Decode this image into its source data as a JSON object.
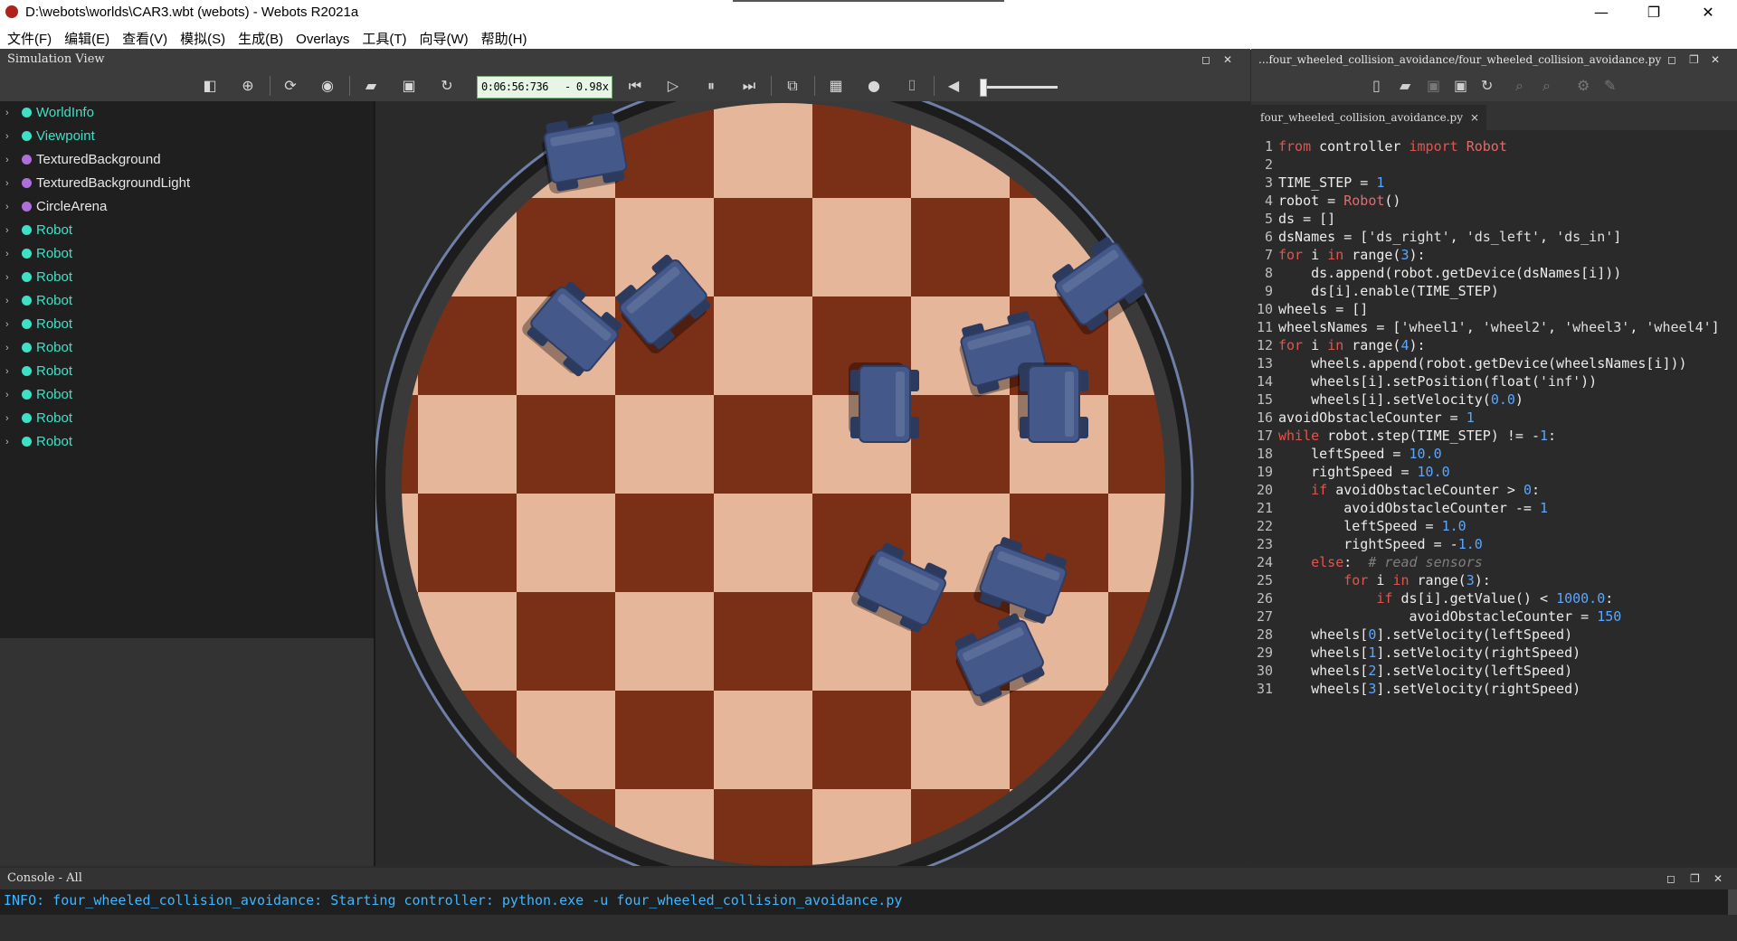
{
  "window": {
    "title": "D:\\webots\\worlds\\CAR3.wbt (webots) - Webots R2021a",
    "minimize": "—",
    "maximize": "❐",
    "close": "✕"
  },
  "menu": [
    "文件(F)",
    "编辑(E)",
    "查看(V)",
    "模拟(S)",
    "生成(B)",
    "Overlays",
    "工具(T)",
    "向导(W)",
    "帮助(H)"
  ],
  "simulation_view": {
    "title": "Simulation View",
    "time": "0:06:56:736",
    "separator": "-",
    "speed": "0.98x"
  },
  "scene_tree": [
    {
      "label": "WorldInfo",
      "color": "#3fe0c5"
    },
    {
      "label": "Viewpoint",
      "color": "#3fe0c5"
    },
    {
      "label": "TexturedBackground",
      "color": "#b06fd8"
    },
    {
      "label": "TexturedBackgroundLight",
      "color": "#b06fd8"
    },
    {
      "label": "CircleArena",
      "color": "#b06fd8"
    },
    {
      "label": "Robot",
      "color": "#3fe0c5"
    },
    {
      "label": "Robot",
      "color": "#3fe0c5"
    },
    {
      "label": "Robot",
      "color": "#3fe0c5"
    },
    {
      "label": "Robot",
      "color": "#3fe0c5"
    },
    {
      "label": "Robot",
      "color": "#3fe0c5"
    },
    {
      "label": "Robot",
      "color": "#3fe0c5"
    },
    {
      "label": "Robot",
      "color": "#3fe0c5"
    },
    {
      "label": "Robot",
      "color": "#3fe0c5"
    },
    {
      "label": "Robot",
      "color": "#3fe0c5"
    },
    {
      "label": "Robot",
      "color": "#3fe0c5"
    }
  ],
  "editor": {
    "panel_title": "...four_wheeled_collision_avoidance/four_wheeled_collision_avoidance.py",
    "tab_label": "four_wheeled_collision_avoidance.py",
    "tab_close": "×",
    "code": [
      "from controller import Robot",
      "",
      "TIME_STEP = 1",
      "robot = Robot()",
      "ds = []",
      "dsNames = ['ds_right', 'ds_left', 'ds_in']",
      "for i in range(3):",
      "    ds.append(robot.getDevice(dsNames[i]))",
      "    ds[i].enable(TIME_STEP)",
      "wheels = []",
      "wheelsNames = ['wheel1', 'wheel2', 'wheel3', 'wheel4']",
      "for i in range(4):",
      "    wheels.append(robot.getDevice(wheelsNames[i]))",
      "    wheels[i].setPosition(float('inf'))",
      "    wheels[i].setVelocity(0.0)",
      "avoidObstacleCounter = 1",
      "while robot.step(TIME_STEP) != -1:",
      "    leftSpeed = 10.0",
      "    rightSpeed = 10.0",
      "    if avoidObstacleCounter > 0:",
      "        avoidObstacleCounter -= 1",
      "        leftSpeed = 1.0",
      "        rightSpeed = -1.0",
      "    else:  # read sensors",
      "        for i in range(3):",
      "            if ds[i].getValue() < 1000.0:",
      "                avoidObstacleCounter = 150",
      "    wheels[0].setVelocity(leftSpeed)",
      "    wheels[1].setVelocity(rightSpeed)",
      "    wheels[2].setVelocity(leftSpeed)",
      "    wheels[3].setVelocity(rightSpeed)"
    ]
  },
  "console": {
    "title": "Console - All",
    "message": "INFO: four_wheeled_collision_avoidance: Starting controller: python.exe -u four_wheeled_collision_avoidance.py"
  },
  "colors": {
    "dark_square": "#7a2f17",
    "light_square": "#e6b69a",
    "robot_body": "#44598a",
    "node_teal": "#3fe0c5",
    "node_purple": "#b06fd8",
    "console_text": "#3fb6ff"
  },
  "robots": [
    {
      "angle": -10
    },
    {
      "angle": -40
    },
    {
      "angle": 40
    },
    {
      "angle": -35
    },
    {
      "angle": -15
    },
    {
      "angle": 90
    },
    {
      "angle": 90
    },
    {
      "angle": 25
    },
    {
      "angle": 20
    },
    {
      "angle": -25
    }
  ]
}
